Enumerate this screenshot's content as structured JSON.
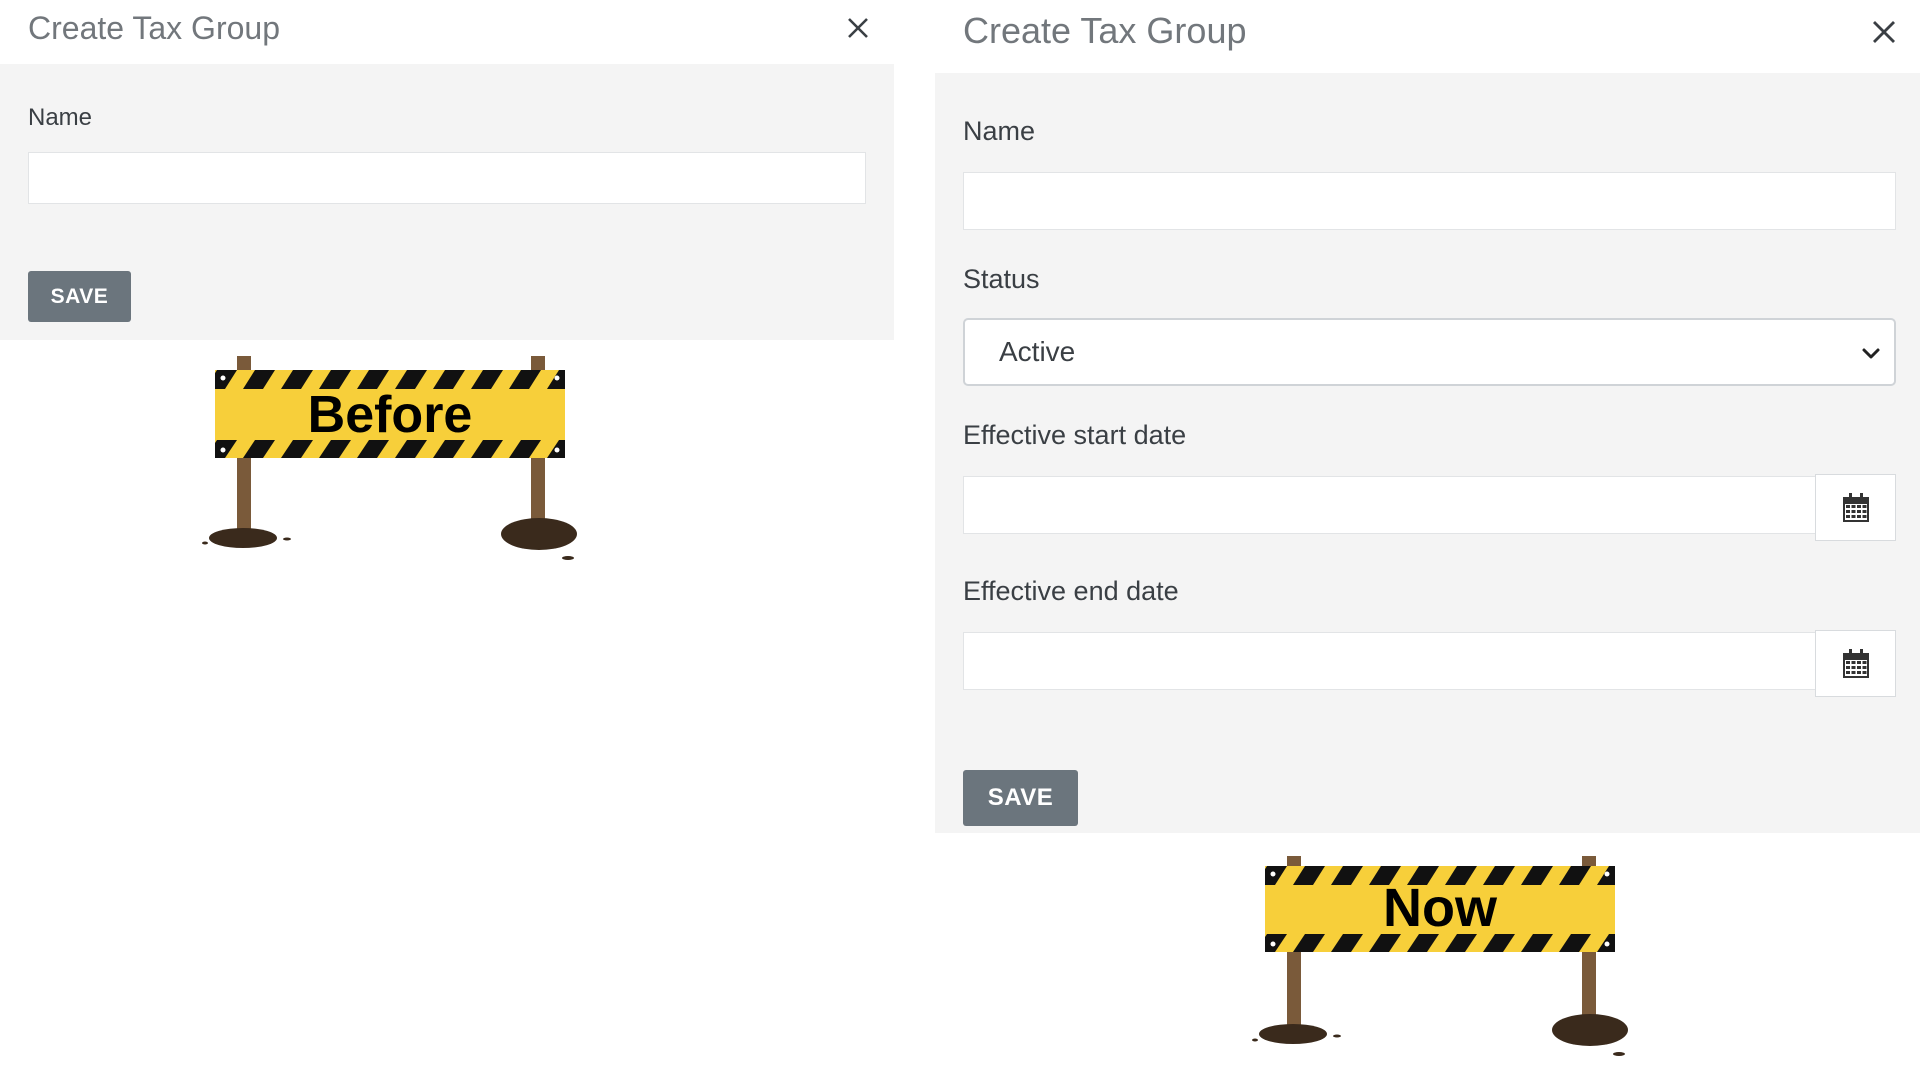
{
  "before": {
    "title": "Create Tax Group",
    "close_icon": "close-icon",
    "name_label": "Name",
    "name_value": "",
    "save_label": "SAVE",
    "sign_text": "Before"
  },
  "now": {
    "title": "Create Tax Group",
    "close_icon": "close-icon",
    "name_label": "Name",
    "name_value": "",
    "status_label": "Status",
    "status_value": "Active",
    "start_date_label": "Effective start date",
    "start_date_value": "",
    "end_date_label": "Effective end date",
    "end_date_value": "",
    "calendar_icon": "calendar-icon",
    "save_label": "SAVE",
    "sign_text": "Now"
  },
  "colors": {
    "panel_bg": "#f4f4f4",
    "button_bg": "#6b757d",
    "title_text": "#72777c",
    "sign_yellow": "#f7cf3a",
    "sign_stripe": "#111111",
    "post_brown": "#7a5a3a"
  }
}
